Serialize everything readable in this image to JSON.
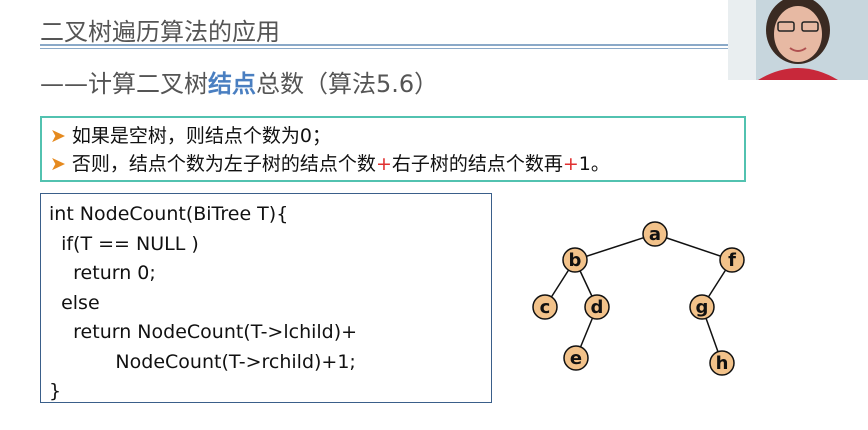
{
  "header": {
    "title": "二叉树遍历算法的应用",
    "subtitle_prefix": "——计算二叉树",
    "subtitle_highlight": "结点",
    "subtitle_suffix": "总数（算法5.6）"
  },
  "rules": [
    {
      "text": "如果是空树，则结点个数为0；"
    },
    {
      "text_a": "否则，结点个数为左子树的结点个数",
      "plus_a": "+",
      "text_b": "右子树的结点个数再",
      "plus_b": "+",
      "text_c": "1。"
    }
  ],
  "code": [
    "int NodeCount(BiTree T){",
    "  if(T == NULL )",
    "    return 0;",
    "  else",
    "    return NodeCount(T->lchild)+",
    "           NodeCount(T->rchild)+1;",
    "}"
  ],
  "tree": {
    "node_color": "#f2c28a",
    "nodes": [
      "a",
      "b",
      "f",
      "c",
      "d",
      "g",
      "e",
      "h"
    ]
  }
}
